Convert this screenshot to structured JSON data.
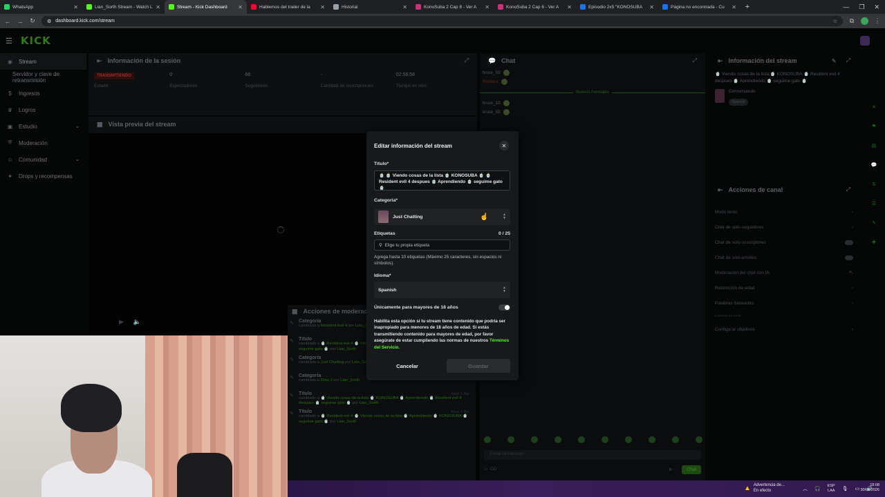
{
  "browser": {
    "tabs": [
      {
        "title": "WhatsApp",
        "color": "#25d366"
      },
      {
        "title": "Lian_Sorth Stream - Watch Live",
        "color": "#53fc18"
      },
      {
        "title": "Stream - Kick Dashboard",
        "color": "#53fc18",
        "active": true
      },
      {
        "title": "Hablemos del trailer de la",
        "color": "#ff0033"
      },
      {
        "title": "Historial",
        "color": "#9aa0a6"
      },
      {
        "title": "KonoSuba 2 Cap 8 - Ver A",
        "color": "#c7337a"
      },
      {
        "title": "KonoSuba 2 Cap 6 - Ver A",
        "color": "#c7337a"
      },
      {
        "title": "Episodio 2x5 \"KONOSUBA",
        "color": "#1a73e8"
      },
      {
        "title": "Página no encontrada - Cu",
        "color": "#1a73e8"
      }
    ],
    "url": "dashboard.kick.com/stream"
  },
  "app": {
    "logo": "KICK",
    "sidebar": [
      {
        "label": "Stream",
        "icon": "broadcast-icon",
        "active": true
      },
      {
        "label": "Servidor y clave de retransmisión",
        "sub": true
      },
      {
        "label": "Ingresos",
        "icon": "money-icon"
      },
      {
        "label": "Logros",
        "icon": "trophy-icon"
      },
      {
        "label": "Estudio",
        "icon": "studio-icon",
        "chevron": true
      },
      {
        "label": "Moderación",
        "icon": "shield-icon"
      },
      {
        "label": "Comunidad",
        "icon": "community-icon",
        "chevron": true
      },
      {
        "label": "Drops y recompensas",
        "icon": "gift-icon"
      }
    ],
    "session": {
      "title": "Información de la sesión",
      "stats": [
        {
          "value": "TRANSMITIENDO",
          "label": "Estado",
          "badge": true
        },
        {
          "value": "0",
          "label": "Espectadores"
        },
        {
          "value": "68",
          "label": "Seguidores"
        },
        {
          "value": "-",
          "label": "Cantidad de suscripciones"
        },
        {
          "value": "02:58:58",
          "label": "Tiempo en vivo"
        }
      ]
    },
    "preview": {
      "title": "Vista previa del stream"
    },
    "moderation": {
      "title": "Acciones de moderación",
      "rows": [
        {
          "type": "Categoría",
          "desc_pre": "cambiada a",
          "desc_val": "Resident Evil 4",
          "desc_by": "por",
          "user": "Lian_Sorth",
          "time": ""
        },
        {
          "type": "Título",
          "desc_pre": "cambiado a",
          "desc_val": "🍵 Resident evil 4 🍵 Viendo cosas de la lista 🍵 KONOSUBA 🍵 Aprendiendo 🍵 seguime gato 🍵",
          "desc_by": "por",
          "user": "Lian_Sorth",
          "time": ""
        },
        {
          "type": "Categoría",
          "desc_pre": "cambiada a",
          "desc_val": "Just Chatting",
          "desc_by": "por",
          "user": "Lian_Sorth",
          "time": "hace 16 horas"
        },
        {
          "type": "Categoría",
          "desc_pre": "cambiada a",
          "desc_val": "Dota 2",
          "desc_by": "por",
          "user": "Lian_Sorth",
          "time": "hace 21 horas"
        },
        {
          "type": "Título",
          "desc_pre": "cambiado a",
          "desc_val": "🍵 Viendo cosas de la lista 🍵 KONOSUBA 🍵 Aprendiendo 🍵 Resident evil 4 despues 🍵 seguime gato 🍵",
          "desc_by": "por",
          "user": "Lian_Sorth",
          "time": "hace 1 día"
        },
        {
          "type": "Título",
          "desc_pre": "cambiado a",
          "desc_val": "🍵 Resident evil 4 🍵 Viendo cosas de la lista 🍵 Aprendiendo 🍵 KONOSUBA 🍵 seguime gato 🍵",
          "desc_by": "por",
          "user": "Lian_Sorth",
          "time": "hace 1 día"
        }
      ]
    },
    "chat": {
      "title": "Chat",
      "messages": [
        {
          "user": "bruce_33:",
          "text": ""
        },
        {
          "user": "Rosfeira:",
          "text": "",
          "red": true
        },
        {
          "user": "bruce_33:",
          "text": ""
        },
        {
          "user": "bruce_33:",
          "text": ""
        }
      ],
      "new_messages": "Nuevos mensajes",
      "input_placeholder": "Enviar un mensaje",
      "viewers": "CO",
      "send": "Chat"
    },
    "stream_info": {
      "title": "Información del stream",
      "stream_title": "🍵 Viendo cosas de la lista 🍵 KONOSUBA 🍵 Resident evil 4 despues 🍵 Aprendiendo 🍵 seguime gato 🍵",
      "category": "Conversando",
      "language": "Spanish"
    },
    "channel_actions": {
      "title": "Acciones de canal",
      "items": [
        {
          "label": "Modo lento",
          "kind": "arrow"
        },
        {
          "label": "Chat de solo-seguidores",
          "kind": "arrow"
        },
        {
          "label": "Chat de solo-suscriptores",
          "kind": "toggle"
        },
        {
          "label": "Chat de solo-emotes",
          "kind": "toggle"
        },
        {
          "label": "Moderación del chat con IA",
          "kind": "link"
        },
        {
          "label": "Restricción de edad",
          "kind": "arrow"
        },
        {
          "label": "Palabras baneadas",
          "kind": "arrow"
        },
        {
          "label": "Límites de chat",
          "kind": "dim"
        },
        {
          "label": "Configurar objetivos",
          "kind": "arrow"
        }
      ]
    }
  },
  "modal": {
    "title": "Editar información del stream",
    "title_label": "Título*",
    "title_value": "🍵 🍵 Viendo cosas de la lista 🍵 KONOSUBA 🍵 🍵 Resident evil 4 despues 🍵 Aprendiendo 🍵 seguime gato 🍵",
    "category_label": "Categoría*",
    "category_value": "Just Chatting",
    "tags_label": "Etiquetas",
    "tags_count": "0 / 25",
    "tags_placeholder": "Elige tu propia etiqueta",
    "tags_help": "Agrega hasta 10 etiquetas (Máximo 25 caracteres, sin espacios ni símbolos).",
    "language_label": "Idioma*",
    "language_value": "Spanish",
    "mature_label": "Únicamente para mayores de 18 años",
    "mature_help": "Habilita esta opción si tu stream tiene contenido que podría ser inapropiado para menores de 18 años de edad. Si estás transmitiendo contenido para mayores de edad, por favor asegúrate de estar cumpliendo las normas de nuestros",
    "mature_link": "Términos del Servicio.",
    "cancel": "Cancelar",
    "save": "Guardar"
  },
  "taskbar": {
    "warning_title": "Advertencia de...",
    "warning_sub": "En efecto",
    "lang1": "ESP",
    "lang2": "LAA",
    "time": "18:08",
    "date": "30/03/2026"
  }
}
